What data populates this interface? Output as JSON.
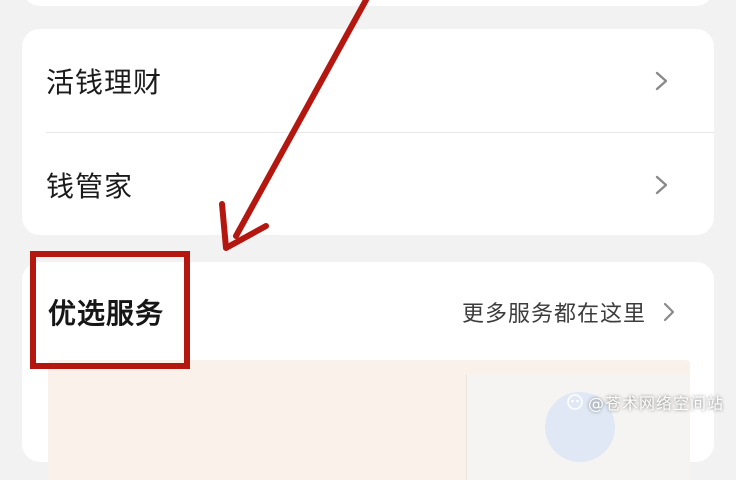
{
  "rows": [
    {
      "label": "活钱理财"
    },
    {
      "label": "钱管家"
    }
  ],
  "section": {
    "title": "优选服务",
    "more_link": "更多服务都在这里"
  },
  "annotation": {
    "highlight_color": "#b3170f",
    "arrow_color": "#b3170f"
  },
  "watermark": {
    "text": "@苍术网络空间站"
  },
  "icons": {
    "chevron": "chevron-right-icon",
    "watermark": "watermark-icon"
  }
}
